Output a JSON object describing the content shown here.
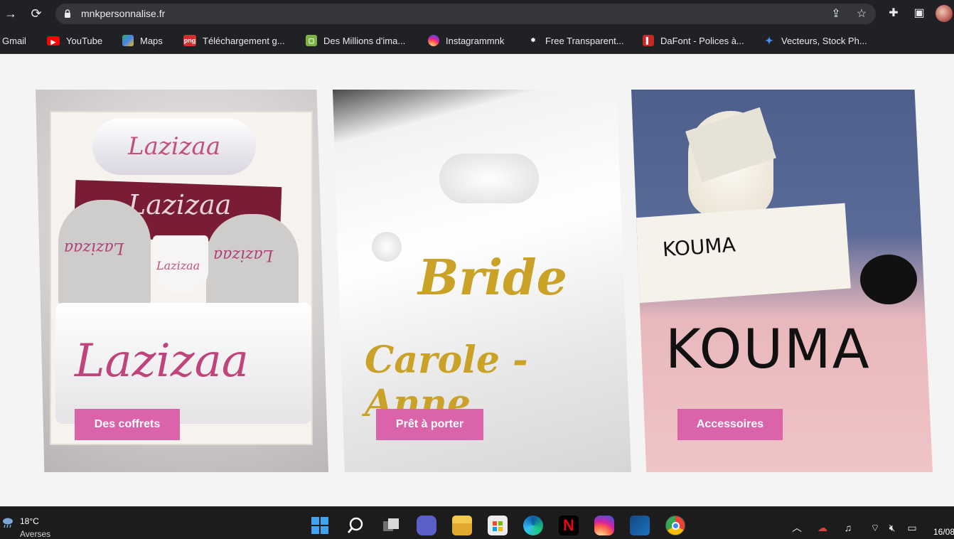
{
  "browser": {
    "url": "mnkpersonnalise.fr",
    "bookmarks": [
      {
        "label": "Gmail"
      },
      {
        "label": "YouTube"
      },
      {
        "label": "Maps"
      },
      {
        "label": "Téléchargement g...",
        "icon_text": "png"
      },
      {
        "label": "Des Millions d'ima..."
      },
      {
        "label": "Instagrammnk"
      },
      {
        "label": "Free Transparent..."
      },
      {
        "label": "DaFont - Polices à..."
      },
      {
        "label": "Vecteurs, Stock Ph..."
      }
    ]
  },
  "cards": [
    {
      "button": "Des coffrets",
      "words": [
        "Lazizaa",
        "Lazizaa",
        "Lazizaa",
        "Lazizaa",
        "Lazizaa",
        "Lazizaa"
      ]
    },
    {
      "button": "Prêt à porter",
      "words": [
        "Bride",
        "Carole - Anne"
      ]
    },
    {
      "button": "Accessoires",
      "words": [
        "KOUMA",
        "KOUMA"
      ]
    }
  ],
  "taskbar": {
    "weather_temp": "18°C",
    "weather_desc": "Averses",
    "clock": "16/08",
    "apps": [
      "windows-start",
      "search",
      "task-view",
      "teams-chat",
      "file-explorer",
      "microsoft-store",
      "edge",
      "netflix",
      "instagram",
      "affinity-designer",
      "chrome"
    ]
  },
  "colors": {
    "accent_button": "#db63aa",
    "chrome_bg": "#202124"
  }
}
